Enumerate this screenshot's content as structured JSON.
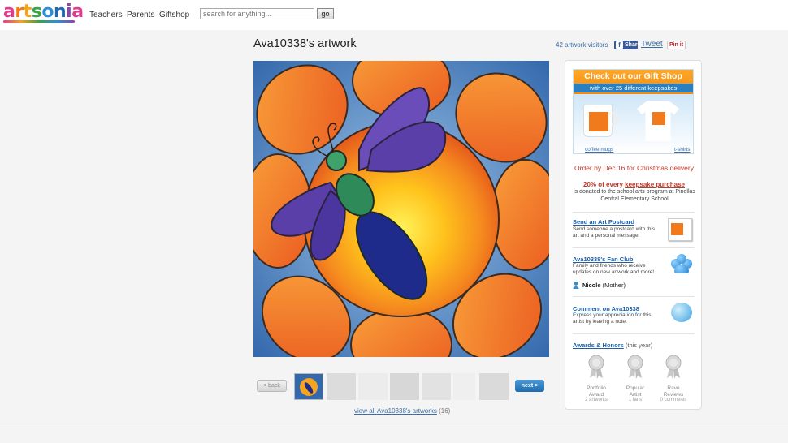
{
  "header": {
    "logo_letters": [
      "a",
      "r",
      "t",
      "s",
      "o",
      "n",
      "i",
      "a"
    ],
    "logo_colors": [
      "#e23b8e",
      "#f07a1c",
      "#f7a21b",
      "#3aa346",
      "#2f8fd6",
      "#1f6bb0",
      "#8e44ad",
      "#e23b8e"
    ],
    "nav": {
      "teachers": "Teachers",
      "parents": "Parents",
      "giftshop": "Giftshop"
    },
    "search_placeholder": "search for anything...",
    "go_label": "go"
  },
  "title_row": {
    "title": "Ava10338's artwork",
    "visitors": "42 artwork visitors",
    "share_label": "Share",
    "tweet_label": "Tweet",
    "pin_label": "Pin it"
  },
  "gallery": {
    "back_label": "< back",
    "next_label": "next >",
    "view_all_label": "view all Ava10338's artworks",
    "view_all_count": "(16)"
  },
  "sidebar": {
    "gift": {
      "title": "Check out our Gift Shop",
      "subtitle": "with over 25 different keepsakes",
      "mugs_label": "coffee mugs",
      "shirts_label": "t-shirts"
    },
    "order_line": "Order by Dec 16 for Christmas delivery",
    "donate_pct": "20% of every",
    "donate_link": "keepsake purchase",
    "donate_text": "is donated to the school arts program at Pinellas Central Elementary School",
    "postcard": {
      "title": "Send an Art Postcard",
      "desc": "Send someone a postcard with this art and a personal message!"
    },
    "fanclub": {
      "title": "Ava10338's Fan Club",
      "desc": "Family and friends who receive updates on new artwork and more!",
      "member_name": "Nicole",
      "member_relation": "(Mother)"
    },
    "comment": {
      "title": "Comment on Ava10338",
      "desc": "Express your appreciation for this artist by leaving a note."
    },
    "awards": {
      "title": "Awards & Honors",
      "period": "(this year)",
      "items": [
        {
          "name1": "Portfolio",
          "name2": "Award",
          "count": "2 artworks"
        },
        {
          "name1": "Popular",
          "name2": "Artist",
          "count": "1 fans"
        },
        {
          "name1": "Rave",
          "name2": "Reviews",
          "count": "0 comments"
        }
      ]
    }
  },
  "colors": {
    "link": "#3b6ea5",
    "gift_orange": "#f28b0c",
    "order_red": "#c0392b",
    "next_blue": "#1f6bb0"
  }
}
